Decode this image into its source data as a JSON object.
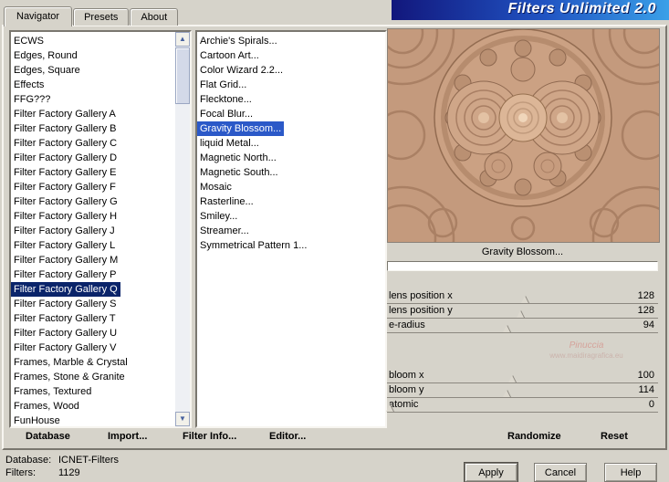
{
  "banner": {
    "title": "Filters Unlimited 2.0"
  },
  "tabs": {
    "items": [
      "Navigator",
      "Presets",
      "About"
    ],
    "selected": "Navigator"
  },
  "categories": {
    "items": [
      "ECWS",
      "Edges, Round",
      "Edges, Square",
      "Effects",
      "FFG???",
      "Filter Factory Gallery A",
      "Filter Factory Gallery B",
      "Filter Factory Gallery C",
      "Filter Factory Gallery D",
      "Filter Factory Gallery E",
      "Filter Factory Gallery F",
      "Filter Factory Gallery G",
      "Filter Factory Gallery H",
      "Filter Factory Gallery J",
      "Filter Factory Gallery L",
      "Filter Factory Gallery M",
      "Filter Factory Gallery P",
      "Filter Factory Gallery Q",
      "Filter Factory Gallery S",
      "Filter Factory Gallery T",
      "Filter Factory Gallery U",
      "Filter Factory Gallery V",
      "Frames, Marble & Crystal",
      "Frames, Stone & Granite",
      "Frames, Textured",
      "Frames, Wood",
      "FunHouse"
    ],
    "selected": "Filter Factory Gallery Q"
  },
  "filters": {
    "items": [
      "Archie's Spirals...",
      "Cartoon Art...",
      "Color Wizard 2.2...",
      "Flat Grid...",
      "Flecktone...",
      "Focal Blur...",
      "Gravity Blossom...",
      "liquid Metal...",
      "Magnetic North...",
      "Magnetic South...",
      "Mosaic",
      "Rasterline...",
      "Smiley...",
      "Streamer...",
      "Symmetrical Pattern 1..."
    ],
    "selected": "Gravity Blossom..."
  },
  "preview": {
    "caption": "Gravity Blossom...",
    "progress_percent": 0
  },
  "sliders": {
    "group1": [
      {
        "label": "lens position x",
        "value": "128",
        "pct": 51
      },
      {
        "label": "lens position y",
        "value": "128",
        "pct": 49
      },
      {
        "label": "e-radius",
        "value": "94",
        "pct": 44
      }
    ],
    "group2": [
      {
        "label": "bloom x",
        "value": "100",
        "pct": 46
      },
      {
        "label": "bloom y",
        "value": "114",
        "pct": 44
      },
      {
        "label": "atomic",
        "value": "0",
        "pct": 1
      }
    ]
  },
  "watermark": {
    "line1": "Pinuccia",
    "line2": "www.maidiragrafica.eu"
  },
  "toolbar": {
    "database": "Database",
    "import": "Import...",
    "filter_info": "Filter Info...",
    "editor": "Editor...",
    "randomize": "Randomize",
    "reset": "Reset"
  },
  "status": {
    "database_label": "Database:",
    "database_value": "ICNET-Filters",
    "filters_label": "Filters:",
    "filters_value": "1129"
  },
  "buttons": {
    "apply": "Apply",
    "cancel": "Cancel",
    "help": "Help"
  },
  "colors": {
    "selection_navy": "#0a246a",
    "selection_blue": "#2b59c8",
    "banner_dark": "#12177c",
    "banner_mid": "#2053c2",
    "banner_light": "#3aa0e8"
  }
}
